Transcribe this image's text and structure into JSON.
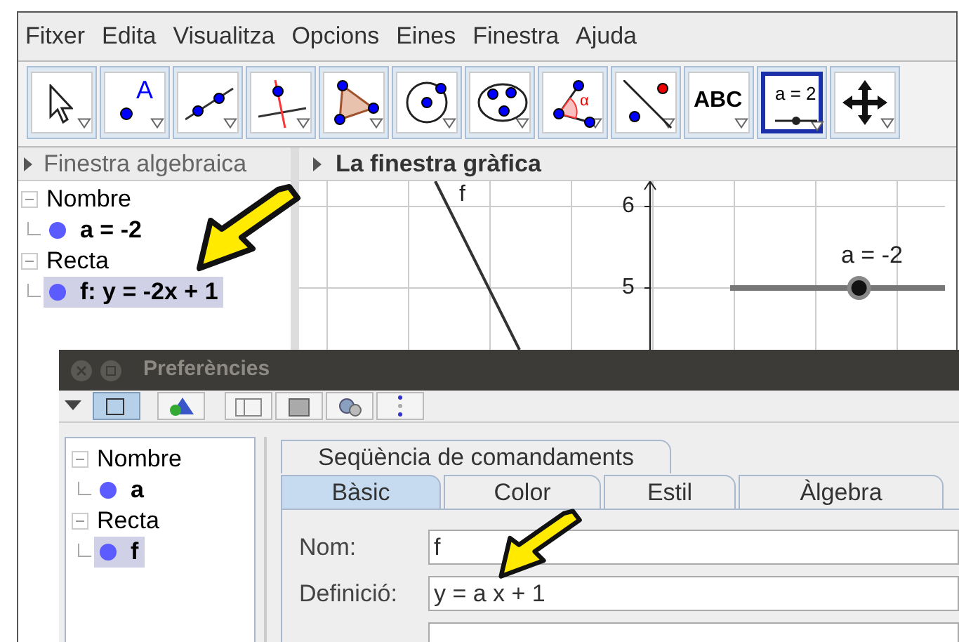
{
  "menu": [
    "Fitxer",
    "Edita",
    "Visualitza",
    "Opcions",
    "Eines",
    "Finestra",
    "Ajuda"
  ],
  "toolbar": [
    {
      "kind": "move",
      "selected": false
    },
    {
      "kind": "point",
      "glyph": "A",
      "selected": false
    },
    {
      "kind": "line",
      "selected": false
    },
    {
      "kind": "perpendicular",
      "selected": false
    },
    {
      "kind": "polygon",
      "selected": false
    },
    {
      "kind": "circle",
      "selected": false
    },
    {
      "kind": "conic",
      "selected": false
    },
    {
      "kind": "angle",
      "glyph": "α",
      "selected": false
    },
    {
      "kind": "reflect",
      "selected": false
    },
    {
      "kind": "text",
      "glyph": "ABC",
      "selected": false
    },
    {
      "kind": "slider",
      "glyph": "a = 2",
      "selected": true
    },
    {
      "kind": "pan",
      "selected": false
    }
  ],
  "algebra_view": {
    "title": "Finestra algebraica",
    "groups": [
      {
        "label": "Nombre",
        "expanded": true,
        "items": [
          {
            "label": "a = -2",
            "selected": false
          }
        ]
      },
      {
        "label": "Recta",
        "expanded": true,
        "items": [
          {
            "label": "f: y = -2x + 1",
            "selected": true
          }
        ]
      }
    ]
  },
  "graphics_view": {
    "title": "La finestra gràfica",
    "line_label": "f",
    "y_ticks": [
      "6",
      "5"
    ],
    "slider_label": "a = -2",
    "slider": {
      "level": 0.6
    }
  },
  "dialog": {
    "title": "Preferències",
    "toolbar": [
      {
        "kind": "graphics",
        "selected": true
      },
      {
        "kind": "shapes",
        "selected": false
      },
      {
        "kind": "layout",
        "selected": false
      },
      {
        "kind": "defaults",
        "selected": false
      },
      {
        "kind": "advanced",
        "selected": false
      },
      {
        "kind": "more",
        "selected": false
      }
    ],
    "tree": [
      {
        "label": "Nombre",
        "items": [
          {
            "label": "a",
            "selected": false
          }
        ]
      },
      {
        "label": "Recta",
        "items": [
          {
            "label": "f",
            "selected": true
          }
        ]
      }
    ],
    "tab_rows": [
      [
        {
          "label": "Seqüència de comandaments",
          "selected": false
        }
      ],
      [
        {
          "label": "Bàsic",
          "selected": true
        },
        {
          "label": "Color",
          "selected": false
        },
        {
          "label": "Estil",
          "selected": false
        },
        {
          "label": "Àlgebra",
          "selected": false
        }
      ]
    ],
    "fields": [
      {
        "label": "Nom:",
        "value": "f"
      },
      {
        "label": "Definició:",
        "value": "y = a x + 1"
      }
    ]
  }
}
